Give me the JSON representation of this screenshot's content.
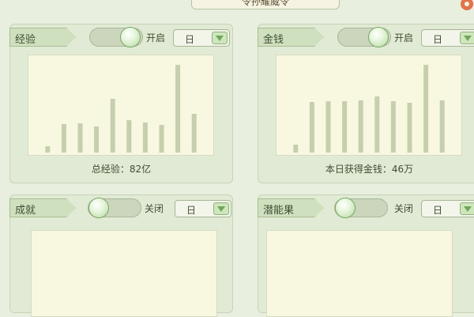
{
  "header": {
    "title": "令孙耀威令"
  },
  "colors": {
    "bar": "#c6cfad",
    "panel": "#e1ead4",
    "chart_bg": "#f8f7df",
    "accent": "#6ea65a",
    "gear": "#e0744a"
  },
  "icons": {
    "settings": "gear-icon",
    "dropdown": "triangle-down-icon"
  },
  "panels": [
    {
      "label": "经验",
      "toggle_label": "开启",
      "toggle_on": true,
      "select_value": "日",
      "summary": "总经验：82亿",
      "chart_data": {
        "type": "bar",
        "values": [
          8,
          36,
          37,
          33,
          68,
          41,
          38,
          35,
          111,
          49
        ]
      }
    },
    {
      "label": "金钱",
      "toggle_label": "开启",
      "toggle_on": true,
      "select_value": "日",
      "summary": "本日获得金钱：46万",
      "chart_data": {
        "type": "bar",
        "values": [
          10,
          64,
          65,
          65,
          66,
          71,
          65,
          63,
          111,
          66
        ]
      }
    },
    {
      "label": "成就",
      "toggle_label": "关闭",
      "toggle_on": false,
      "select_value": "日"
    },
    {
      "label": "潜能果",
      "toggle_label": "关闭",
      "toggle_on": false,
      "select_value": "日"
    }
  ]
}
